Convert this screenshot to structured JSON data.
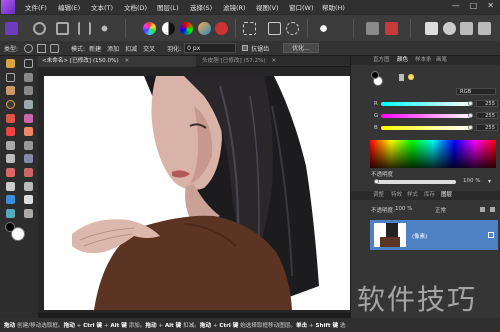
{
  "menubar": {
    "items": [
      "文件(F)",
      "编辑(E)",
      "文本(T)",
      "文档(D)",
      "图层(L)",
      "选择(S)",
      "滤镜(R)",
      "视图(V)",
      "窗口(W)",
      "帮助(H)"
    ],
    "window_controls": [
      "—",
      "□",
      "✕"
    ]
  },
  "context": {
    "type_label": "类型:",
    "pattern_label": "模式:",
    "mode_new": "新建",
    "mode_add": "添加",
    "mode_subtract": "扣减",
    "mode_intersect": "交叉",
    "feather_label": "羽化:",
    "feather_value": "0 px",
    "antialias_label": "抗锯齿",
    "refine_button": "优化..."
  },
  "documents": {
    "tab1": "<未命名> [已修改] (150.0%)",
    "tab2": "头皮胆 [已修改] (57.2%)"
  },
  "colors": {
    "accent": "#4e82c4",
    "panel_bg": "#353535",
    "toolbar_bg": "#3c3c3c"
  },
  "color_panel": {
    "tabs": [
      "直方图",
      "颜色",
      "样本条",
      "画笔"
    ],
    "mode_value": "RGB",
    "r_label": "R",
    "g_label": "G",
    "b_label": "B",
    "r_value": "255",
    "g_value": "255",
    "b_value": "255",
    "opacity_label": "不透明度",
    "opacity_value": "100 %"
  },
  "layers_panel": {
    "tabs": [
      "调整",
      "特效",
      "样式",
      "库存",
      "图层"
    ],
    "opacity_label": "不透明度:",
    "opacity_value": "100 %",
    "blend_mode": "正常",
    "layer_name": "(像素)"
  },
  "statusbar": {
    "text1": "拖动",
    "text2": " 创建/移动选取框。",
    "text3": "拖动",
    "text4": " + ",
    "text5": "Ctrl 键",
    "text6": " + ",
    "text7": "Alt 键",
    "text8": " 添加。",
    "text9": "拖动",
    "text10": " + ",
    "text11": "Alt 键",
    "text12": " 扣减。",
    "text13": "拖动",
    "text14": " + ",
    "text15": "Ctrl 键",
    "text16": " 始选择取框移动图层。",
    "text17": "单击",
    "text18": " + ",
    "text19": "Shift 键",
    "text20": " 选"
  },
  "watermark": "软件技巧"
}
